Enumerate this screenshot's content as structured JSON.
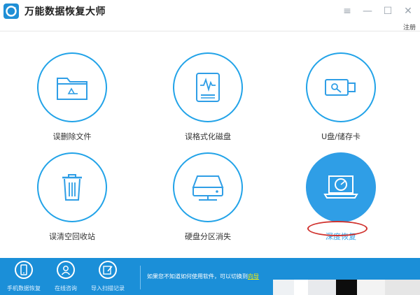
{
  "app": {
    "title": "万能数据恢复大师",
    "register": "注册"
  },
  "window_controls": {
    "menu": "≡",
    "minimize": "—",
    "maximize": "☐",
    "close": "✕"
  },
  "tiles": [
    {
      "label": "误删除文件",
      "icon": "folder-recycle-icon"
    },
    {
      "label": "误格式化磁盘",
      "icon": "disk-waveform-icon"
    },
    {
      "label": "U盘/储存卡",
      "icon": "usb-drive-icon"
    },
    {
      "label": "误清空回收站",
      "icon": "trash-bin-icon"
    },
    {
      "label": "硬盘分区消失",
      "icon": "hard-drive-network-icon"
    },
    {
      "label": "深度恢复",
      "icon": "laptop-disc-icon"
    }
  ],
  "bottom_bar": {
    "items": [
      {
        "label": "手机数据恢复",
        "icon": "phone-icon"
      },
      {
        "label": "在线咨询",
        "icon": "user-icon"
      },
      {
        "label": "导入扫描记录",
        "icon": "edit-import-icon"
      }
    ],
    "hint": "如果您不知道如何使用软件，可以切换到",
    "hint_link": "向导"
  },
  "colors": {
    "accent": "#22a3e8",
    "bottom_bar": "#1b8fd8",
    "highlight_ring": "#d0312d"
  }
}
